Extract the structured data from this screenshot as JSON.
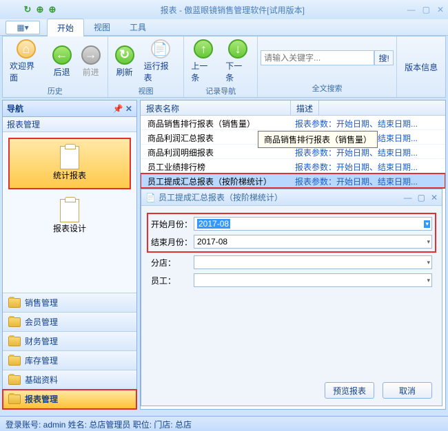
{
  "window": {
    "title": "报表 - 傲蓝眼镜销售管理软件[试用版本]"
  },
  "menubar": {
    "tabs": [
      "开始",
      "视图",
      "工具"
    ]
  },
  "ribbon": {
    "history": {
      "label": "历史",
      "welcome": "欢迎界面",
      "back": "后退",
      "forward": "前进"
    },
    "view": {
      "label": "视图",
      "refresh": "刷新",
      "run": "运行报表"
    },
    "recnav": {
      "label": "记录导航",
      "prev": "上一条",
      "next": "下一条"
    },
    "search": {
      "label": "全文搜索",
      "placeholder": "请输入关键字...",
      "btn": "搜!"
    },
    "version": "版本信息"
  },
  "nav": {
    "title": "导航",
    "section": "报表管理",
    "items": [
      {
        "label": "统计报表"
      },
      {
        "label": "报表设计"
      }
    ],
    "cats": [
      "销售管理",
      "会员管理",
      "财务管理",
      "库存管理",
      "基础资料",
      "报表管理"
    ]
  },
  "grid": {
    "headers": [
      "报表名称",
      "描述"
    ],
    "rows": [
      {
        "name": "商品销售排行报表（销售量）",
        "desc": "报表参数：开始日期、结束日期..."
      },
      {
        "name": "商品利润汇总报表",
        "desc": "报表参数：开始日期、结束日期..."
      },
      {
        "name": "商品利润明细报表",
        "desc": "报表参数：开始日期、结束日期..."
      },
      {
        "name": "员工业绩排行榜",
        "desc": "报表参数：开始日期、结束日期..."
      },
      {
        "name": "员工提成汇总报表（按阶梯统计）",
        "desc": "报表参数：开始日期、结束日期..."
      }
    ],
    "tooltip": "商品销售排行报表（销售量）"
  },
  "dialog": {
    "title": "员工提成汇总报表（按阶梯统计）",
    "start_label": "开始月份：",
    "start_val": "2017-08",
    "end_label": "结束月份：",
    "end_val": "2017-08",
    "branch_label": "分店：",
    "emp_label": "员工：",
    "preview": "预览报表",
    "cancel": "取消"
  },
  "status": "登录账号: admin  姓名: 总店管理员  职位:   门店: 总店"
}
